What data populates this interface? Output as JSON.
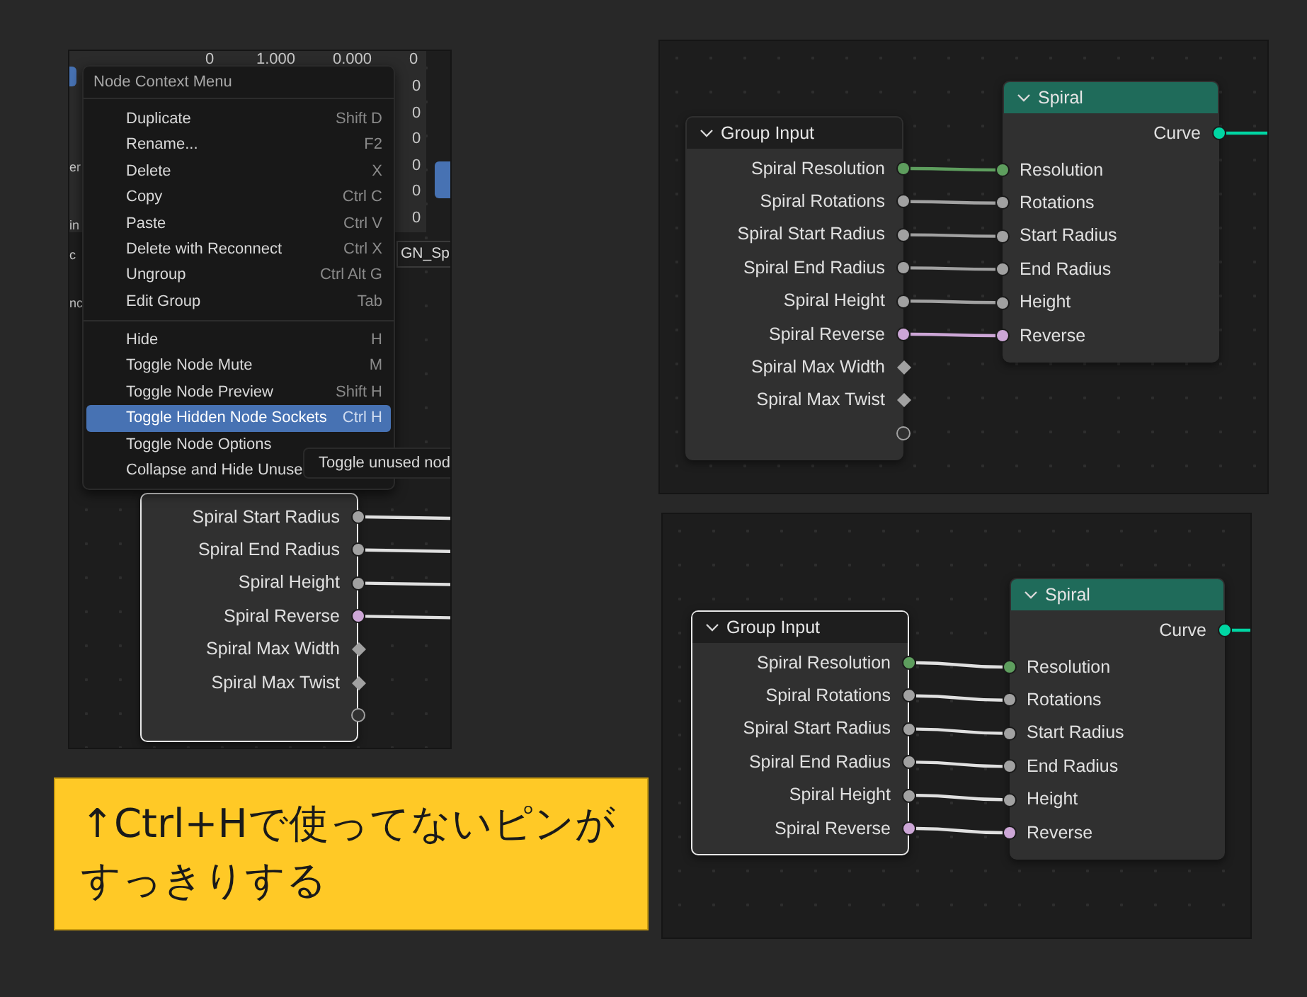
{
  "left_panel": {
    "background_texts": [
      {
        "text": "0",
        "kind": "top"
      },
      {
        "text": "1.000",
        "kind": "top"
      },
      {
        "text": "0.000",
        "kind": "top"
      },
      {
        "text": "0",
        "kind": "top"
      },
      {
        "text": "0",
        "kind": "column"
      },
      {
        "text": "0",
        "kind": "column"
      },
      {
        "text": "0",
        "kind": "column"
      },
      {
        "text": "0",
        "kind": "column"
      },
      {
        "text": "0",
        "kind": "column"
      },
      {
        "text": "0",
        "kind": "column"
      }
    ],
    "side_texts": [
      "er",
      "in",
      "c",
      "nc"
    ],
    "tab": "GN_Sp",
    "menu": {
      "title": "Node Context Menu",
      "groups": [
        [
          {
            "label": "Duplicate",
            "shortcut": "Shift D",
            "selected": false
          },
          {
            "label": "Rename...",
            "shortcut": "F2",
            "selected": false
          },
          {
            "label": "Delete",
            "shortcut": "X",
            "selected": false
          },
          {
            "label": "Copy",
            "shortcut": "Ctrl C",
            "selected": false
          },
          {
            "label": "Paste",
            "shortcut": "Ctrl V",
            "selected": false
          },
          {
            "label": "Delete with Reconnect",
            "shortcut": "Ctrl X",
            "selected": false
          },
          {
            "label": "Ungroup",
            "shortcut": "Ctrl Alt G",
            "selected": false
          },
          {
            "label": "Edit Group",
            "shortcut": "Tab",
            "selected": false
          }
        ],
        [
          {
            "label": "Hide",
            "shortcut": "H",
            "selected": false
          },
          {
            "label": "Toggle Node Mute",
            "shortcut": "M",
            "selected": false
          },
          {
            "label": "Toggle Node Preview",
            "shortcut": "Shift H",
            "selected": false
          },
          {
            "label": "Toggle Hidden Node Sockets",
            "shortcut": "Ctrl H",
            "selected": true
          },
          {
            "label": "Toggle Node Options",
            "selected": false
          },
          {
            "label": "Collapse and Hide Unuse",
            "selected": false
          }
        ]
      ]
    },
    "tooltip": "Toggle unused nod",
    "node": {
      "selected": true,
      "outputs": [
        {
          "label": "Spiral Start Radius",
          "kind": "circle",
          "color": "#a1a1a1",
          "linked": true
        },
        {
          "label": "Spiral End Radius",
          "kind": "circle",
          "color": "#a1a1a1",
          "linked": true
        },
        {
          "label": "Spiral Height",
          "kind": "circle",
          "color": "#a1a1a1",
          "linked": true
        },
        {
          "label": "Spiral Reverse",
          "kind": "circle",
          "color": "#cca6d6",
          "linked": true
        },
        {
          "label": "Spiral Max Width",
          "kind": "diamond",
          "color": "#a1a1a1",
          "linked": false
        },
        {
          "label": "Spiral Max Twist",
          "kind": "diamond",
          "color": "#a1a1a1",
          "linked": false
        },
        {
          "kind": "virtual",
          "color": "#a1a1a1",
          "linked": false
        }
      ]
    }
  },
  "top_right_panel": {
    "nodes": [
      {
        "title": "Group Input",
        "kind": "input",
        "selected": false,
        "outputs": [
          {
            "label": "Spiral Resolution",
            "kind": "circle",
            "color": "#5e9e5e",
            "linked": true
          },
          {
            "label": "Spiral Rotations",
            "kind": "circle",
            "color": "#a1a1a1",
            "linked": true
          },
          {
            "label": "Spiral Start Radius",
            "kind": "circle",
            "color": "#a1a1a1",
            "linked": true
          },
          {
            "label": "Spiral End Radius",
            "kind": "circle",
            "color": "#a1a1a1",
            "linked": true
          },
          {
            "label": "Spiral Height",
            "kind": "circle",
            "color": "#a1a1a1",
            "linked": true
          },
          {
            "label": "Spiral Reverse",
            "kind": "circle",
            "color": "#cca6d6",
            "linked": true
          },
          {
            "label": "Spiral Max Width",
            "kind": "diamond",
            "color": "#a1a1a1",
            "linked": false
          },
          {
            "label": "Spiral Max Twist",
            "kind": "diamond",
            "color": "#a1a1a1",
            "linked": false
          },
          {
            "kind": "virtual",
            "color": "#a1a1a1",
            "linked": false
          }
        ]
      },
      {
        "title": "Spiral",
        "kind": "curve",
        "selected": false,
        "outputs": [
          {
            "label": "Curve",
            "kind": "circle",
            "color": "#00d6a3",
            "linked": true
          }
        ],
        "inputs": [
          {
            "label": "Resolution",
            "kind": "circle",
            "color": "#5e9e5e"
          },
          {
            "label": "Rotations",
            "kind": "circle",
            "color": "#a1a1a1"
          },
          {
            "label": "Start Radius",
            "kind": "circle",
            "color": "#a1a1a1"
          },
          {
            "label": "End Radius",
            "kind": "circle",
            "color": "#a1a1a1"
          },
          {
            "label": "Height",
            "kind": "circle",
            "color": "#a1a1a1"
          },
          {
            "label": "Reverse",
            "kind": "circle",
            "color": "#cca6d6"
          }
        ]
      }
    ]
  },
  "bottom_right_panel": {
    "nodes": [
      {
        "title": "Group Input",
        "kind": "input",
        "selected": true,
        "outputs": [
          {
            "label": "Spiral Resolution",
            "kind": "circle",
            "color": "#5e9e5e",
            "linked": true
          },
          {
            "label": "Spiral Rotations",
            "kind": "circle",
            "color": "#a1a1a1",
            "linked": true
          },
          {
            "label": "Spiral Start Radius",
            "kind": "circle",
            "color": "#a1a1a1",
            "linked": true
          },
          {
            "label": "Spiral End Radius",
            "kind": "circle",
            "color": "#a1a1a1",
            "linked": true
          },
          {
            "label": "Spiral Height",
            "kind": "circle",
            "color": "#a1a1a1",
            "linked": true
          },
          {
            "label": "Spiral Reverse",
            "kind": "circle",
            "color": "#cca6d6",
            "linked": true
          }
        ]
      },
      {
        "title": "Spiral",
        "kind": "curve",
        "selected": false,
        "outputs": [
          {
            "label": "Curve",
            "kind": "circle",
            "color": "#00d6a3",
            "linked": true
          }
        ],
        "inputs": [
          {
            "label": "Resolution",
            "kind": "circle",
            "color": "#5e9e5e"
          },
          {
            "label": "Rotations",
            "kind": "circle",
            "color": "#a1a1a1"
          },
          {
            "label": "Start Radius",
            "kind": "circle",
            "color": "#a1a1a1"
          },
          {
            "label": "End Radius",
            "kind": "circle",
            "color": "#a1a1a1"
          },
          {
            "label": "Height",
            "kind": "circle",
            "color": "#a1a1a1"
          },
          {
            "label": "Reverse",
            "kind": "circle",
            "color": "#cca6d6"
          }
        ]
      }
    ]
  },
  "caption": {
    "lines": [
      "↑Ctrl+Hで使ってないピンが",
      "すっきりする"
    ]
  }
}
